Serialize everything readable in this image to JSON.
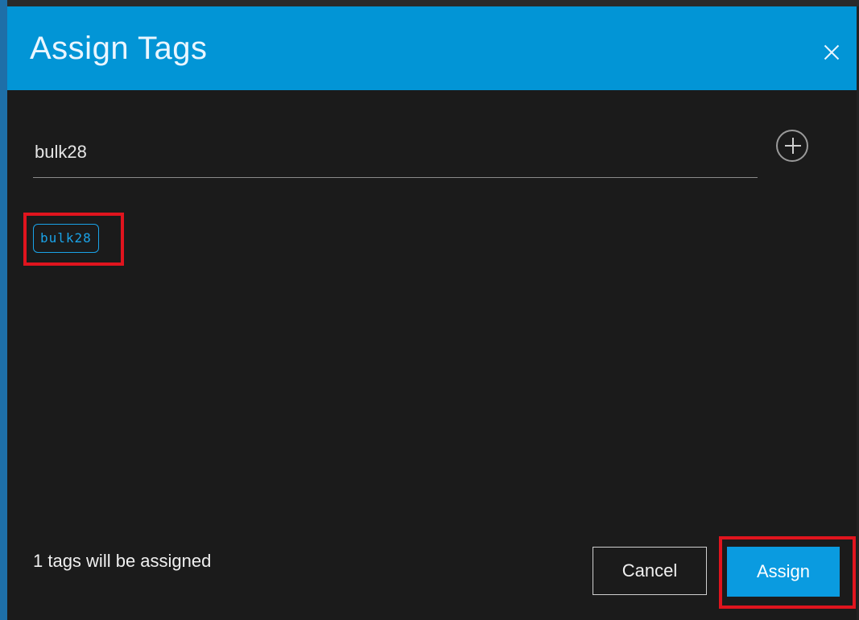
{
  "dialog": {
    "title": "Assign Tags",
    "close_icon": "close-icon"
  },
  "tag_input": {
    "value": "bulk28",
    "add_icon": "plus-circle-icon"
  },
  "tags": [
    {
      "label": "bulk28"
    }
  ],
  "footer": {
    "summary": "1 tags will be assigned",
    "cancel_label": "Cancel",
    "assign_label": "Assign"
  },
  "colors": {
    "header": "#0295d6",
    "background": "#1b1b1b",
    "accent": "#1aa3e8",
    "primary_button": "#0a9be0",
    "highlight": "#e0141e"
  }
}
